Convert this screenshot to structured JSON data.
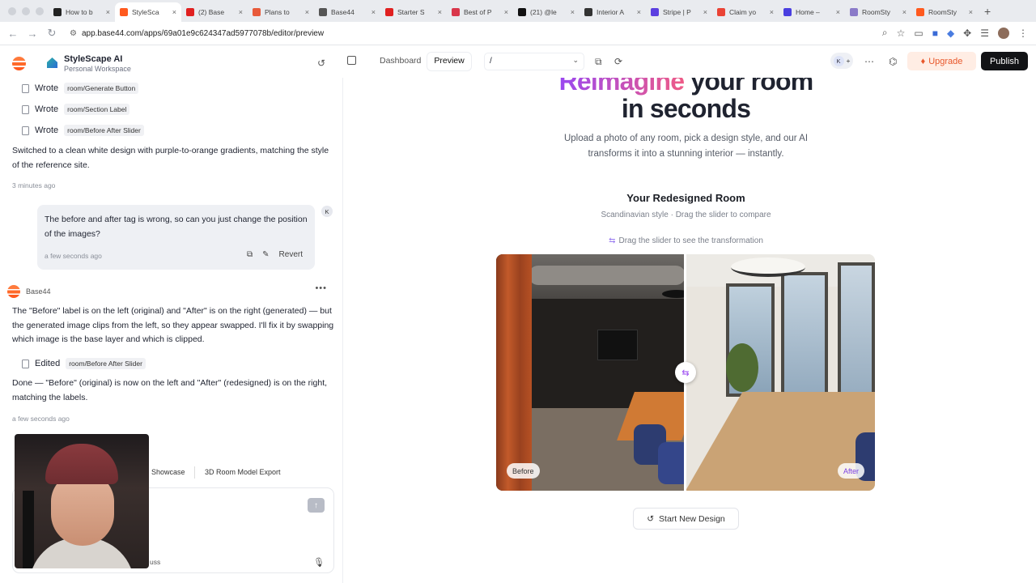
{
  "browser": {
    "tabs": [
      {
        "label": "How to b",
        "color": "#222222",
        "active": false
      },
      {
        "label": "StyleSca",
        "color": "#ff5a1f",
        "active": true
      },
      {
        "label": "(2) Base",
        "color": "#e02020",
        "active": false
      },
      {
        "label": "Plans to",
        "color": "#e85a3a",
        "active": false
      },
      {
        "label": "Base44",
        "color": "#555555",
        "active": false
      },
      {
        "label": "Starter S",
        "color": "#e02020",
        "active": false
      },
      {
        "label": "Best of P",
        "color": "#d9364a",
        "active": false
      },
      {
        "label": "(21) @le",
        "color": "#111111",
        "active": false
      },
      {
        "label": "Interior A",
        "color": "#333333",
        "active": false
      },
      {
        "label": "Stripe | P",
        "color": "#5b3fe0",
        "active": false
      },
      {
        "label": "Claim yo",
        "color": "#ea4335",
        "active": false
      },
      {
        "label": "Home –",
        "color": "#4a3fe0",
        "active": false
      },
      {
        "label": "RoomSty",
        "color": "#8a7ac8",
        "active": false
      },
      {
        "label": "RoomSty",
        "color": "#ff5a1f",
        "active": false
      }
    ],
    "tab_close": "×",
    "new_tab": "+",
    "url": "app.base44.com/apps/69a01e9c624347ad5977078b/editor/preview"
  },
  "header": {
    "app_name": "StyleScape AI",
    "workspace": "Personal Workspace",
    "dashboard": "Dashboard",
    "preview": "Preview",
    "path": "/",
    "user_initial": "K",
    "upgrade": "Upgrade",
    "publish": "Publish"
  },
  "chat": {
    "actions": [
      {
        "verb": "Wrote",
        "file": "room/Generate Button"
      },
      {
        "verb": "Wrote",
        "file": "room/Section Label"
      },
      {
        "verb": "Wrote",
        "file": "room/Before After Slider"
      }
    ],
    "msg1": "Switched to a clean white design with purple-to-orange gradients, matching the style of the reference site.",
    "ts1": "3 minutes ago",
    "user_msg": "The before and after tag is wrong, so can you just change the position of the images?",
    "user_ts": "a few seconds ago",
    "revert": "Revert",
    "user_avatar": "K",
    "assistant_name": "Base44",
    "msg2": "The \"Before\" label is on the left (original) and \"After\" is on the right (generated) — but the generated image clips from the left, so they appear swapped. I'll fix it by swapping which image is the base layer and which is clipped.",
    "edit_action": {
      "verb": "Edited",
      "file": "room/Before After Slider"
    },
    "msg3": "Done — \"Before\" (original) is now on the left and \"After\" (redesigned) is on the right, matching the labels.",
    "ts2": "a few seconds ago",
    "suggestions": [
      "Showcase",
      "3D Room Model Export"
    ],
    "discuss_partial": "uss"
  },
  "preview": {
    "hero_grad": "Reimagine",
    "hero_rest": " your room",
    "hero_line2": "in seconds",
    "hero_sub": "Upload a photo of any room, pick a design style, and our AI transforms it into a stunning interior — instantly.",
    "section_title": "Your Redesigned Room",
    "section_sub": "Scandinavian style · Drag the slider to compare",
    "drag_hint": "Drag the slider to see the transformation",
    "before_tag": "Before",
    "after_tag": "After",
    "new_design": "Start New Design",
    "slider_position": 0.5
  },
  "colors": {
    "accent_purple": "#9a48f0",
    "accent_pink": "#ee5a86",
    "upgrade_text": "#e8572a",
    "publish_bg": "#121316"
  }
}
